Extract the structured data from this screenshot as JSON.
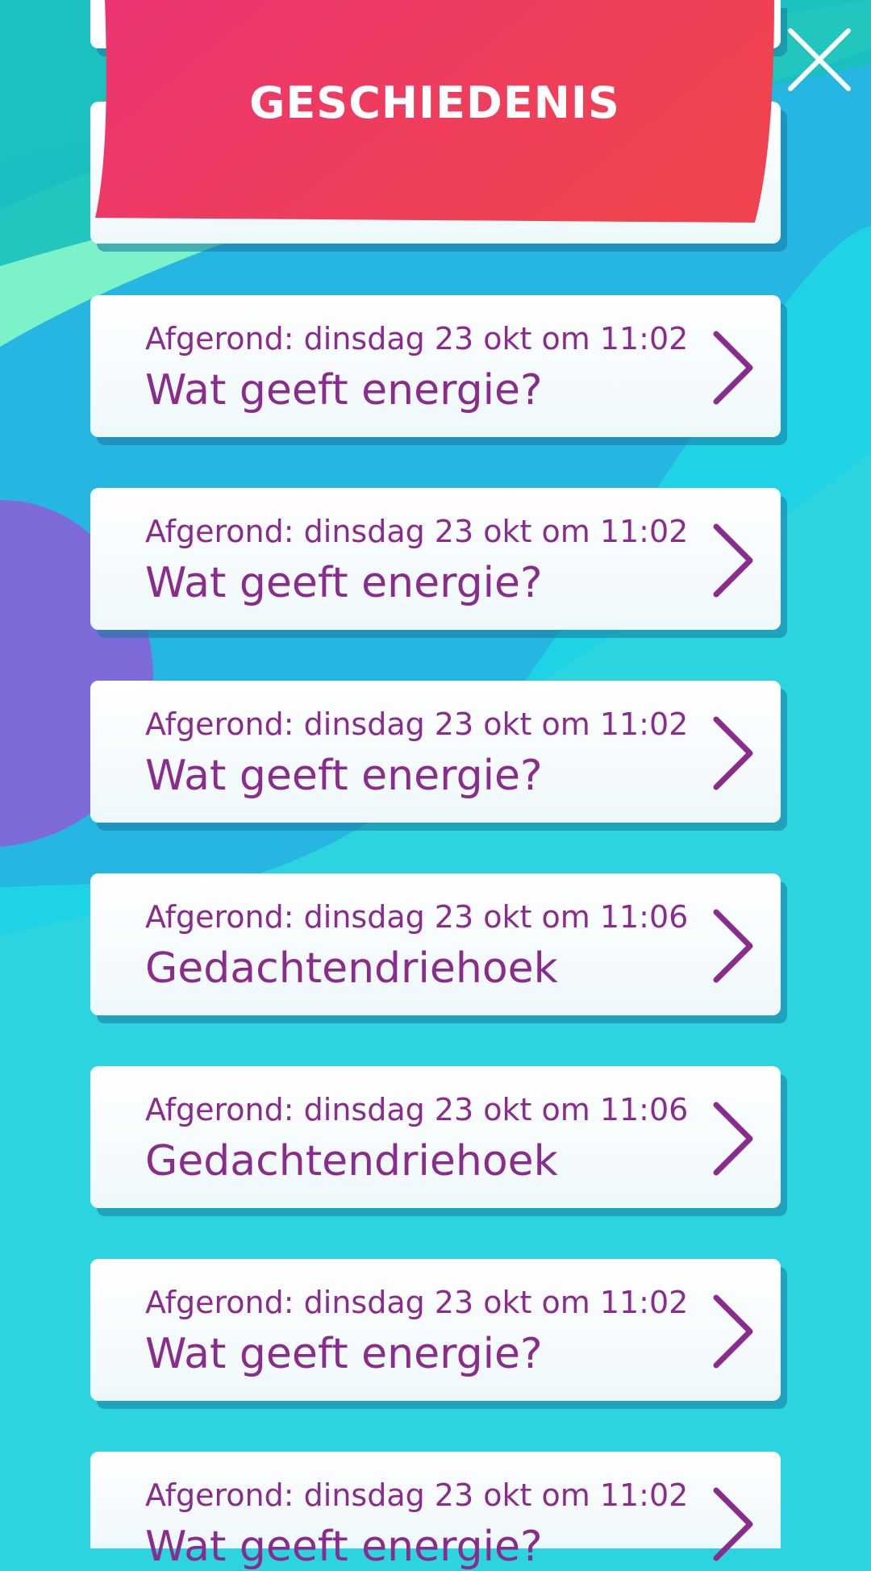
{
  "header": {
    "title": "GESCHIEDENIS"
  },
  "history": {
    "items": [
      {
        "meta": "Afgerond: dinsdag 23 okt om 11:02",
        "title": "Wat geeft energie?"
      },
      {
        "meta": "Afgerond: dinsdag 23 okt om 11:02",
        "title": "Wat geeft energie?"
      },
      {
        "meta": "Afgerond: dinsdag 23 okt om 11:02",
        "title": "Wat geeft energie?"
      },
      {
        "meta": "Afgerond: dinsdag 23 okt om 11:06",
        "title": "Gedachtendriehoek"
      },
      {
        "meta": "Afgerond: dinsdag 23 okt om 11:06",
        "title": "Gedachtendriehoek"
      },
      {
        "meta": "Afgerond: dinsdag 23 okt om 11:02",
        "title": "Wat geeft energie?"
      },
      {
        "meta": "Afgerond: dinsdag 23 okt om 11:02",
        "title": "Wat geeft energie?"
      }
    ]
  },
  "icons": {
    "close": "close-icon",
    "chevron": "chevron-right-icon"
  },
  "colors": {
    "background": "#2cd4df",
    "banner": "#ec3a66",
    "text_purple": "#8a2b8e",
    "card": "#ffffff"
  }
}
